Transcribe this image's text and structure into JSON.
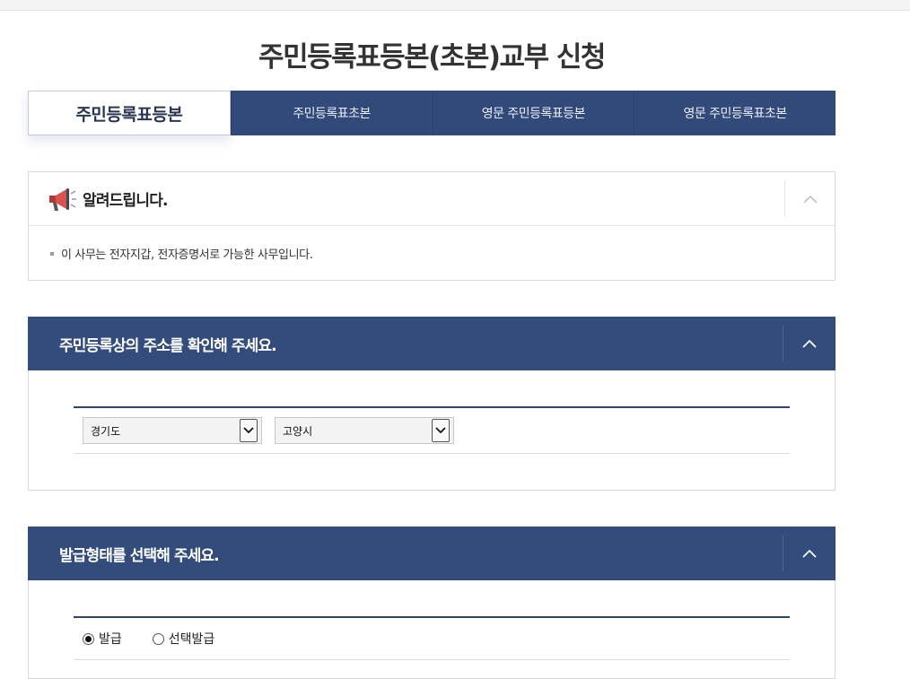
{
  "page_title": "주민등록표등본(초본)교부 신청",
  "tabs": [
    {
      "label": "주민등록표등본",
      "active": true
    },
    {
      "label": "주민등록표초본",
      "active": false
    },
    {
      "label": "영문 주민등록표등본",
      "active": false
    },
    {
      "label": "영문 주민등록표초본",
      "active": false
    }
  ],
  "notice": {
    "title": "알려드립니다.",
    "icon": "megaphone-icon",
    "text": "이 사무는 전자지갑, 전자증명서로 가능한 사무입니다."
  },
  "address_section": {
    "title": "주민등록상의 주소를 확인해 주세요.",
    "province": "경기도",
    "city": "고양시"
  },
  "issue_section": {
    "title": "발급형태를 선택해 주세요.",
    "options": [
      {
        "label": "발급",
        "checked": true
      },
      {
        "label": "선택발급",
        "checked": false
      }
    ]
  },
  "colors": {
    "accent": "#334c7c",
    "tab_bg": "#324a7a"
  }
}
